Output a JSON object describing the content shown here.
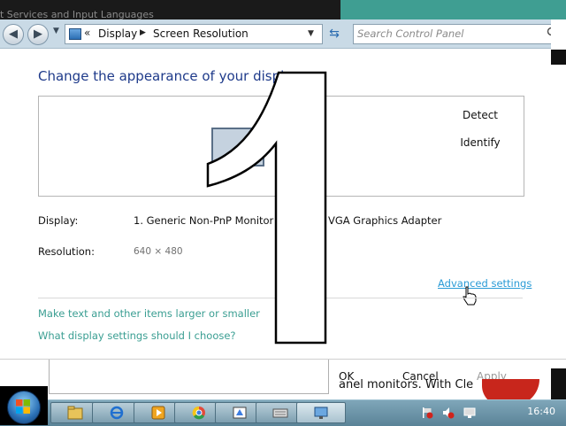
{
  "background_window": {
    "title": "t Services and Input Languages"
  },
  "address_bar": {
    "crumb_chevron": "«",
    "crumbs": [
      "Display",
      "Screen Resolution"
    ],
    "search_placeholder": "Search Control Panel"
  },
  "content": {
    "heading": "Change the appearance of your display",
    "detect_label": "Detect",
    "identify_label": "Identify",
    "display_label": "Display:",
    "display_value": "1. Generic Non-PnP Monitor o",
    "display_value_tail": "VGA Graphics Adapter",
    "resolution_label": "Resolution:",
    "resolution_value": "640 × 480",
    "advanced_settings_link": "Advanced settings",
    "links": [
      "Make text and other items larger or smaller",
      "What display settings should I choose?"
    ]
  },
  "overlay": {
    "big_number": "1"
  },
  "dialog_buttons": {
    "ok": "OK",
    "cancel": "Cancel",
    "apply": "Apply"
  },
  "behind_doc": {
    "text": "anel monitors. With Cle"
  },
  "taskbar": {
    "apps": [
      "explorer-icon",
      "internet-explorer-icon",
      "media-player-icon",
      "chrome-icon",
      "paint-icon",
      "keyboard-icon",
      "display-settings-icon"
    ],
    "clock": "16:40"
  },
  "colors": {
    "link_teal": "#3a9e92",
    "advanced_link": "#2a9bd6",
    "heading_blue": "#1e3a8a",
    "taskbar": "#6b93a6"
  }
}
